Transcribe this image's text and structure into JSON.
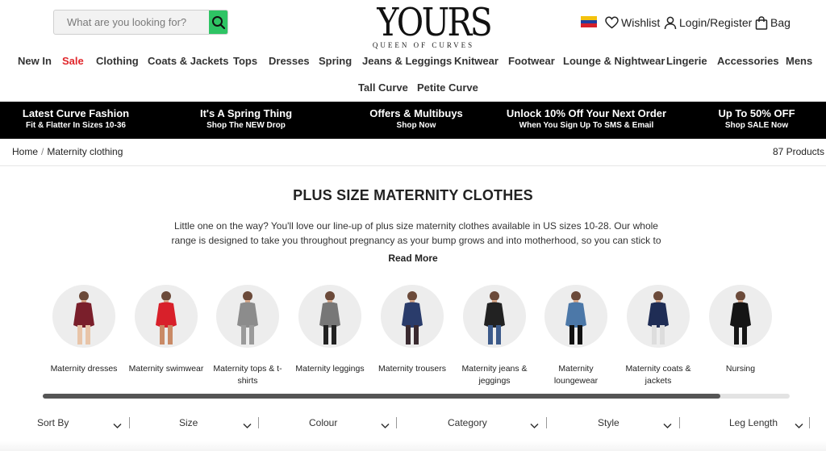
{
  "search": {
    "placeholder": "What are you looking for?"
  },
  "logo": {
    "name": "YOURS",
    "tagline": "QUEEN OF CURVES"
  },
  "header": {
    "wishlist": "Wishlist",
    "login": "Login/Register",
    "bag": "Bag"
  },
  "nav": [
    {
      "label": "New In",
      "color": "#333"
    },
    {
      "label": "Sale",
      "color": "#e0262b"
    },
    {
      "label": "Clothing",
      "color": "#333"
    },
    {
      "label": "Coats & Jackets",
      "color": "#333"
    },
    {
      "label": "Tops",
      "color": "#333"
    },
    {
      "label": "Dresses",
      "color": "#333"
    },
    {
      "label": "Spring",
      "color": "#333"
    },
    {
      "label": "Jeans & Leggings",
      "color": "#333"
    },
    {
      "label": "Knitwear",
      "color": "#333"
    },
    {
      "label": "Footwear",
      "color": "#333"
    },
    {
      "label": "Lounge & Nightwear",
      "color": "#333"
    },
    {
      "label": "Lingerie",
      "color": "#333"
    },
    {
      "label": "Accessories",
      "color": "#333"
    },
    {
      "label": "Mens",
      "color": "#333"
    }
  ],
  "nav2": [
    {
      "label": "Tall Curve"
    },
    {
      "label": "Petite Curve"
    }
  ],
  "promos": [
    {
      "title": "Latest Curve Fashion",
      "sub": "Fit & Flatter In Sizes 10-36"
    },
    {
      "title": "It's A Spring Thing",
      "sub": "Shop The NEW Drop"
    },
    {
      "title": "Offers & Multibuys",
      "sub": "Shop Now"
    },
    {
      "title": "Unlock 10% Off Your Next Order",
      "sub": "When You Sign Up To SMS & Email"
    },
    {
      "title": "Up To 50% OFF",
      "sub": "Shop SALE Now"
    }
  ],
  "breadcrumb": {
    "home": "Home",
    "separator": "/",
    "current": "Maternity clothing"
  },
  "product_count": "87 Products",
  "page": {
    "title": "PLUS SIZE MATERNITY CLOTHES",
    "description": "Little one on the way? You'll love our line-up of plus size maternity clothes available in US sizes 10-28. Our whole range is designed to take you throughout pregnancy as your bump grows and into motherhood, so you can stick to",
    "read_more": "Read More"
  },
  "categories": [
    {
      "label": "Maternity dresses",
      "garment": "#7a1f2b",
      "legs": "#e8c4a8"
    },
    {
      "label": "Maternity swimwear",
      "garment": "#d8202a",
      "legs": "#c98a66"
    },
    {
      "label": "Maternity tops & t-shirts",
      "garment": "#8c8c8c",
      "legs": "#9a9a9a"
    },
    {
      "label": "Maternity leggings",
      "garment": "#777777",
      "legs": "#222222"
    },
    {
      "label": "Maternity trousers",
      "garment": "#2a3c6b",
      "legs": "#3a2a30"
    },
    {
      "label": "Maternity jeans & jeggings",
      "garment": "#222222",
      "legs": "#3c5a8a"
    },
    {
      "label": "Maternity loungewear",
      "garment": "#4c78a8",
      "legs": "#111111"
    },
    {
      "label": "Maternity coats & jackets",
      "garment": "#1f2d55",
      "legs": "#dddddd"
    },
    {
      "label": "Nursing",
      "garment": "#151515",
      "legs": "#151515"
    }
  ],
  "carousel_progress": 0.907,
  "filters": [
    "Sort By",
    "Size",
    "Colour",
    "Category",
    "Style",
    "Leg Length"
  ],
  "colors": {
    "accent_green": "#2ec464",
    "sale_red": "#e0262b",
    "promo_bg": "#000000"
  },
  "icons": [
    "search-icon",
    "venezuela-flag-icon",
    "heart-icon",
    "user-icon",
    "bag-icon",
    "chevron-down-icon"
  ]
}
